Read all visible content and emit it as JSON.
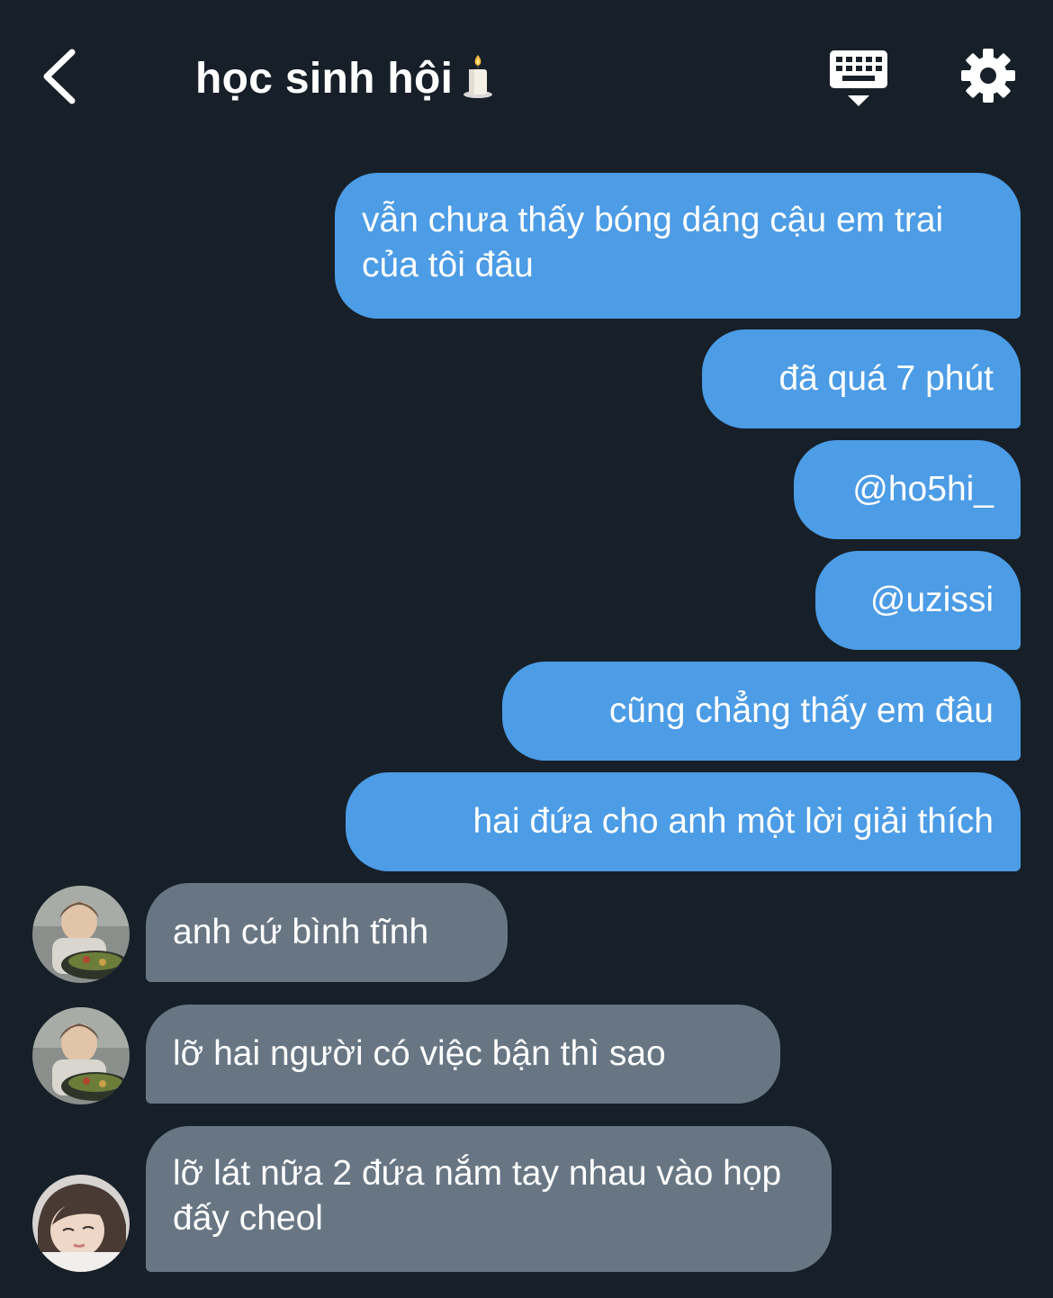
{
  "header": {
    "title": "học sinh hội",
    "title_emoji_icon": "candle-icon",
    "back_icon": "chevron-left-icon",
    "keyboard_icon": "keyboard-icon",
    "settings_icon": "gear-icon"
  },
  "colors": {
    "background": "#172029",
    "sent_bubble": "#4c9ce6",
    "received_bubble": "#687684"
  },
  "messages": [
    {
      "direction": "sent",
      "text": "vẫn chưa thấy bóng dáng cậu em trai của tôi đâu"
    },
    {
      "direction": "sent",
      "text": "đã quá 7 phút"
    },
    {
      "direction": "sent",
      "text": "@ho5hi_"
    },
    {
      "direction": "sent",
      "text": "@uzissi"
    },
    {
      "direction": "sent",
      "text": "cũng chẳng thấy em đâu"
    },
    {
      "direction": "sent",
      "text": "hai đứa cho anh một lời giải thích"
    },
    {
      "direction": "received",
      "text": "anh cứ bình tĩnh",
      "avatar": "avatar-person-eating"
    },
    {
      "direction": "received",
      "text": "lỡ hai người có việc bận thì sao",
      "avatar": "avatar-person-eating"
    },
    {
      "direction": "received",
      "text": "lỡ lát nữa 2 đứa nắm tay nhau vào họp đấy cheol",
      "avatar": "avatar-person-resting"
    }
  ]
}
